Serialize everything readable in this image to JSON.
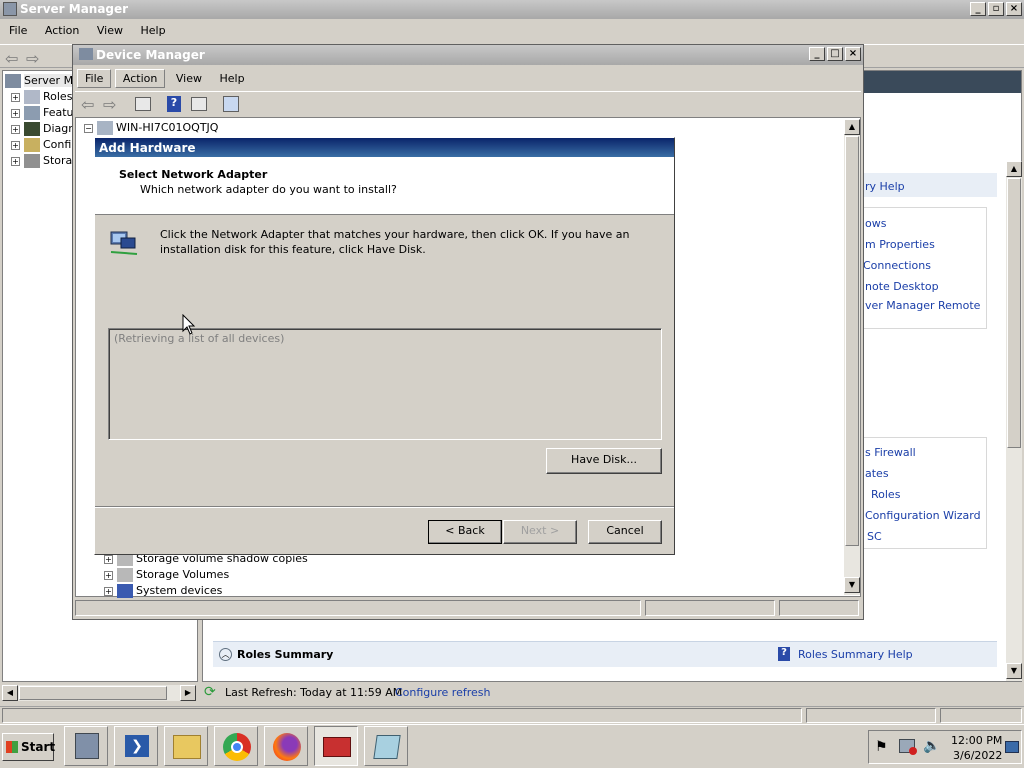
{
  "server_manager": {
    "title": "Server Manager",
    "menu": [
      "File",
      "Action",
      "View",
      "Help"
    ],
    "tree": [
      {
        "label": "Server Ma"
      },
      {
        "label": "Roles"
      },
      {
        "label": "Featu"
      },
      {
        "label": "Diagn"
      },
      {
        "label": "Confi"
      },
      {
        "label": "Stora"
      }
    ],
    "right_links_1": [
      "ry Help"
    ],
    "right_links_2": [
      "ows",
      "m Properties",
      " Connections",
      "note Desktop",
      "ver Manager Remote"
    ],
    "right_links_3": [
      "s Firewall",
      "ates",
      "Roles",
      "Configuration Wizard",
      "SC"
    ],
    "roles_summary": "Roles Summary",
    "roles_summary_help": "Roles Summary Help",
    "last_refresh": "Last Refresh: Today at 11:59 AM",
    "configure_refresh": "Configure refresh"
  },
  "device_manager": {
    "title": "Device Manager",
    "menu": [
      "File",
      "Action",
      "View",
      "Help"
    ],
    "root_node": "WIN-HI7C01OQTJQ",
    "nodes": [
      "Storage volume shadow copies",
      "Storage Volumes",
      "System devices"
    ]
  },
  "add_hardware": {
    "title": "Add Hardware",
    "heading": "Select Network Adapter",
    "subheading": "Which network adapter do you want to install?",
    "instruction_line1": "Click the Network Adapter that matches your hardware, then click OK. If you have an",
    "instruction_line2": "installation disk for this feature, click Have Disk.",
    "list_placeholder": "(Retrieving a list of all devices)",
    "have_disk": "Have Disk...",
    "back": "< Back",
    "next": "Next >",
    "cancel": "Cancel"
  },
  "taskbar": {
    "start": "Start",
    "time": "12:00 PM",
    "date": "3/6/2022"
  },
  "colors": {
    "accent_blue": "#0a246a",
    "link": "#1a3ea8"
  }
}
